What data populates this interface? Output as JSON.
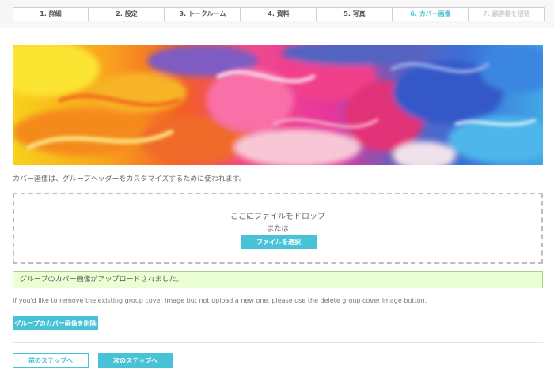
{
  "steps": [
    {
      "label": "1. 詳細",
      "state": "normal"
    },
    {
      "label": "2. 設定",
      "state": "normal"
    },
    {
      "label": "3. トークルーム",
      "state": "normal"
    },
    {
      "label": "4. 資料",
      "state": "normal"
    },
    {
      "label": "5. 写真",
      "state": "normal"
    },
    {
      "label": "6. カバー画像",
      "state": "current"
    },
    {
      "label": "7. 顧客様を招待",
      "state": "disabled"
    }
  ],
  "cover": {
    "description": "カバー画像は、グループヘッダーをカスタマイズするために使われます。"
  },
  "dropzone": {
    "drop_text": "ここにファイルをドロップ",
    "or_text": "または",
    "select_button": "ファイルを選択"
  },
  "alert": {
    "message": "グループのカバー画像がアップロードされました。"
  },
  "note": "If you'd like to remove the existing group cover image but not upload a new one, please use the delete group cover image button.",
  "delete_button": "グループのカバー画像を削除",
  "nav": {
    "prev_button": "前のステップへ",
    "next_button": "次のステップへ"
  },
  "colors": {
    "accent": "#48c2d6",
    "success_bg": "#eaffd4",
    "success_border": "#a9d38a"
  }
}
